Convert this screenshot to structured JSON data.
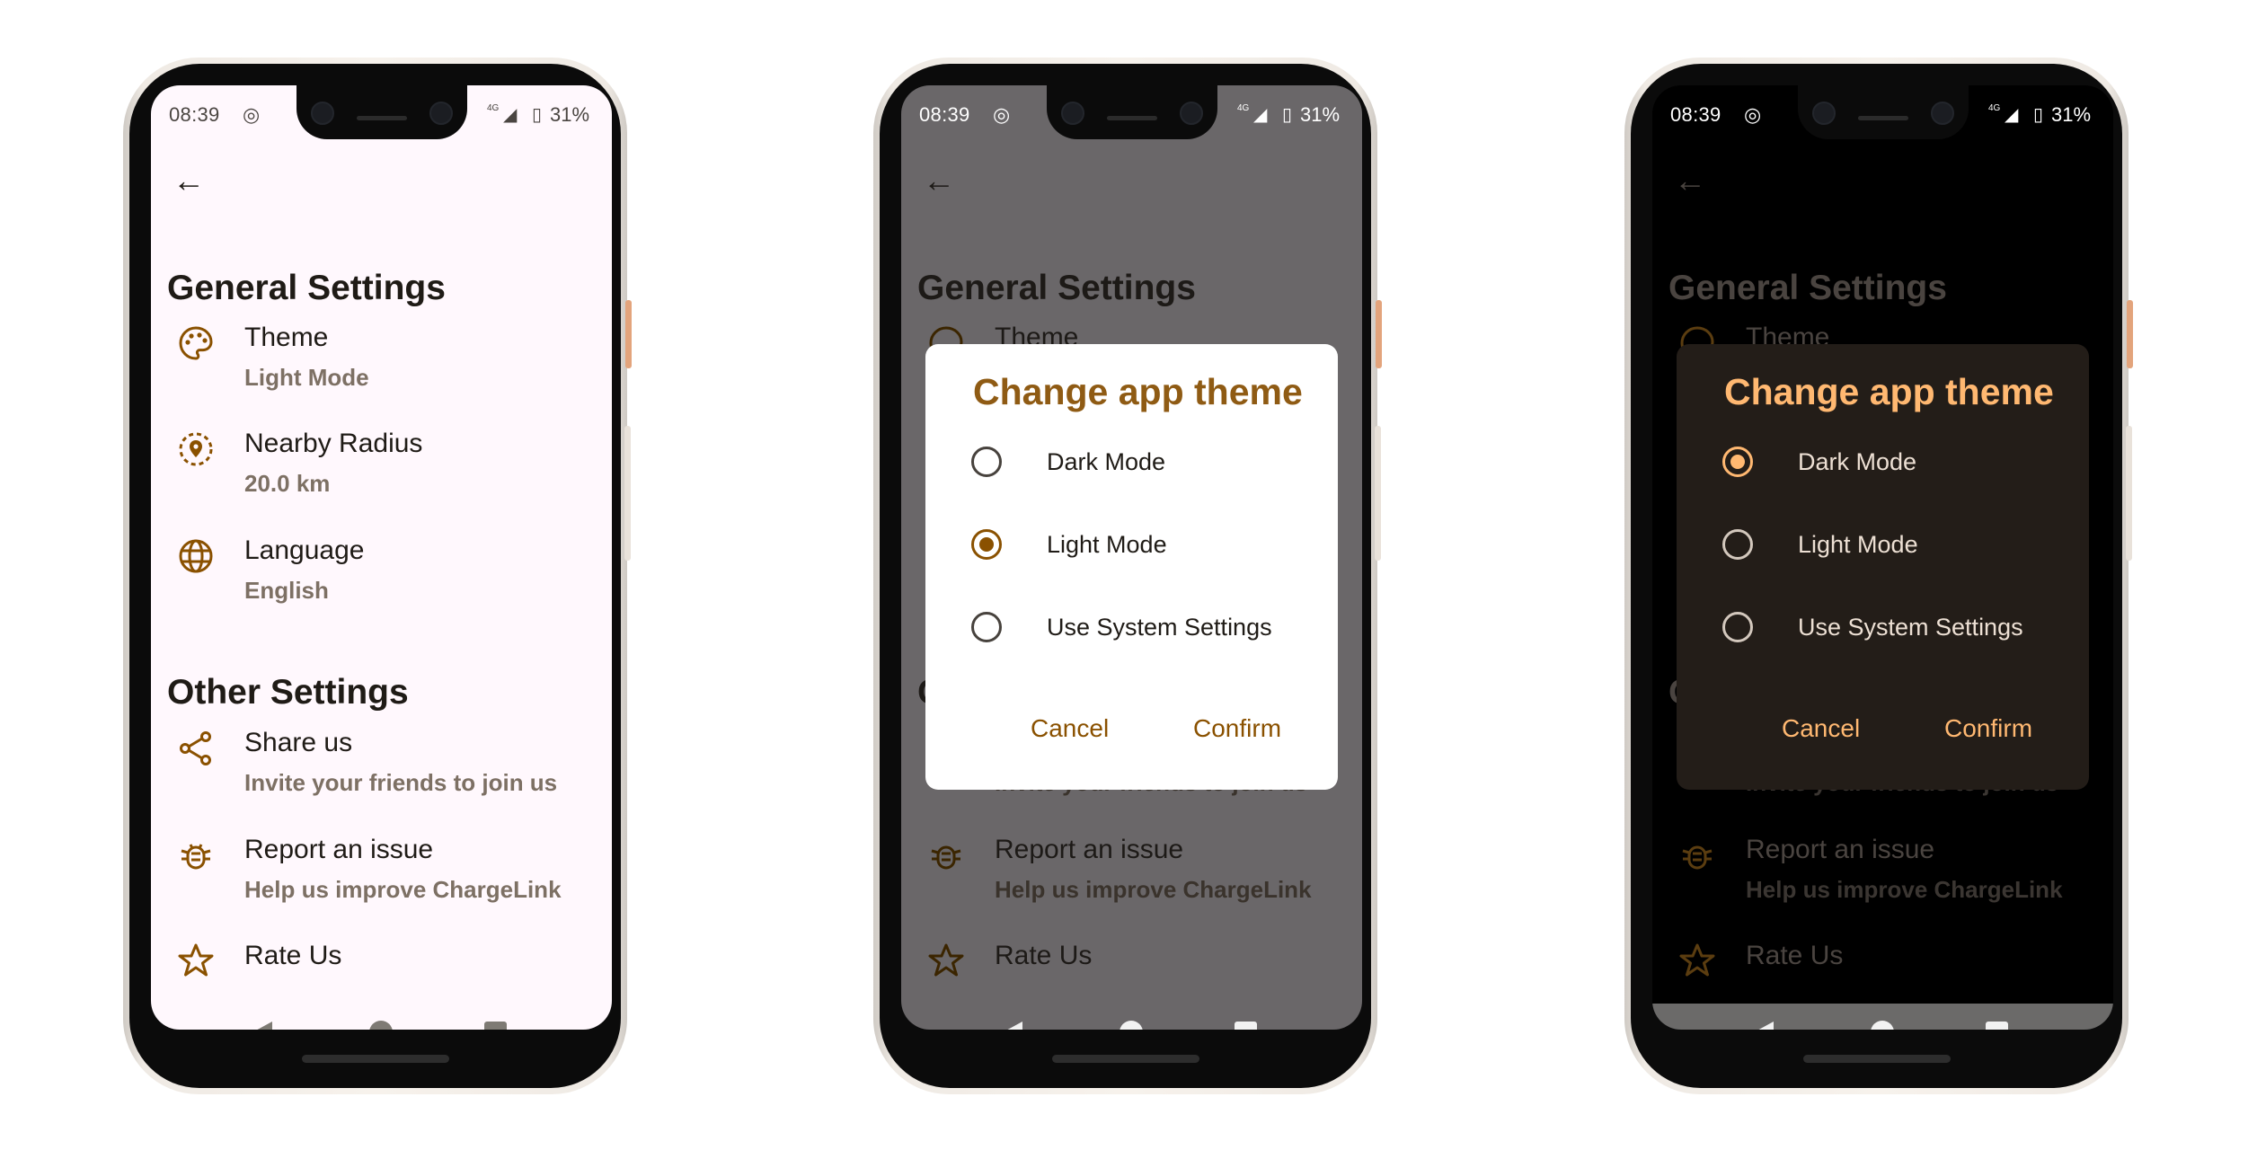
{
  "status": {
    "time": "08:39",
    "network": "4G",
    "battery_pct": "31%"
  },
  "icons": {
    "back": "arrow-left-icon",
    "theme": "palette-icon",
    "radius": "location-radius-icon",
    "language": "globe-icon",
    "share": "share-icon",
    "report": "bug-icon",
    "rate": "star-icon"
  },
  "settings": {
    "general_header": "General Settings",
    "theme_label": "Theme",
    "theme_value": "Light Mode",
    "radius_label": "Nearby Radius",
    "radius_value": "20.0 km",
    "language_label": "Language",
    "language_value": "English",
    "other_header": "Other Settings",
    "share_label": "Share us",
    "share_sub": "Invite your friends to join us",
    "report_label": "Report an issue",
    "report_sub": "Help us improve ChargeLink",
    "rate_label": "Rate Us"
  },
  "dialog": {
    "title": "Change app theme",
    "options": [
      "Dark Mode",
      "Light Mode",
      "Use System Settings"
    ],
    "cancel": "Cancel",
    "confirm": "Confirm",
    "selected_light_screen": "Light Mode",
    "selected_dark_screen": "Dark Mode"
  },
  "colors": {
    "accent_light": "#8a5100",
    "accent_dark": "#ffb871",
    "light_bg": "#fff8fd",
    "dark_dialog_bg": "#231d18"
  }
}
